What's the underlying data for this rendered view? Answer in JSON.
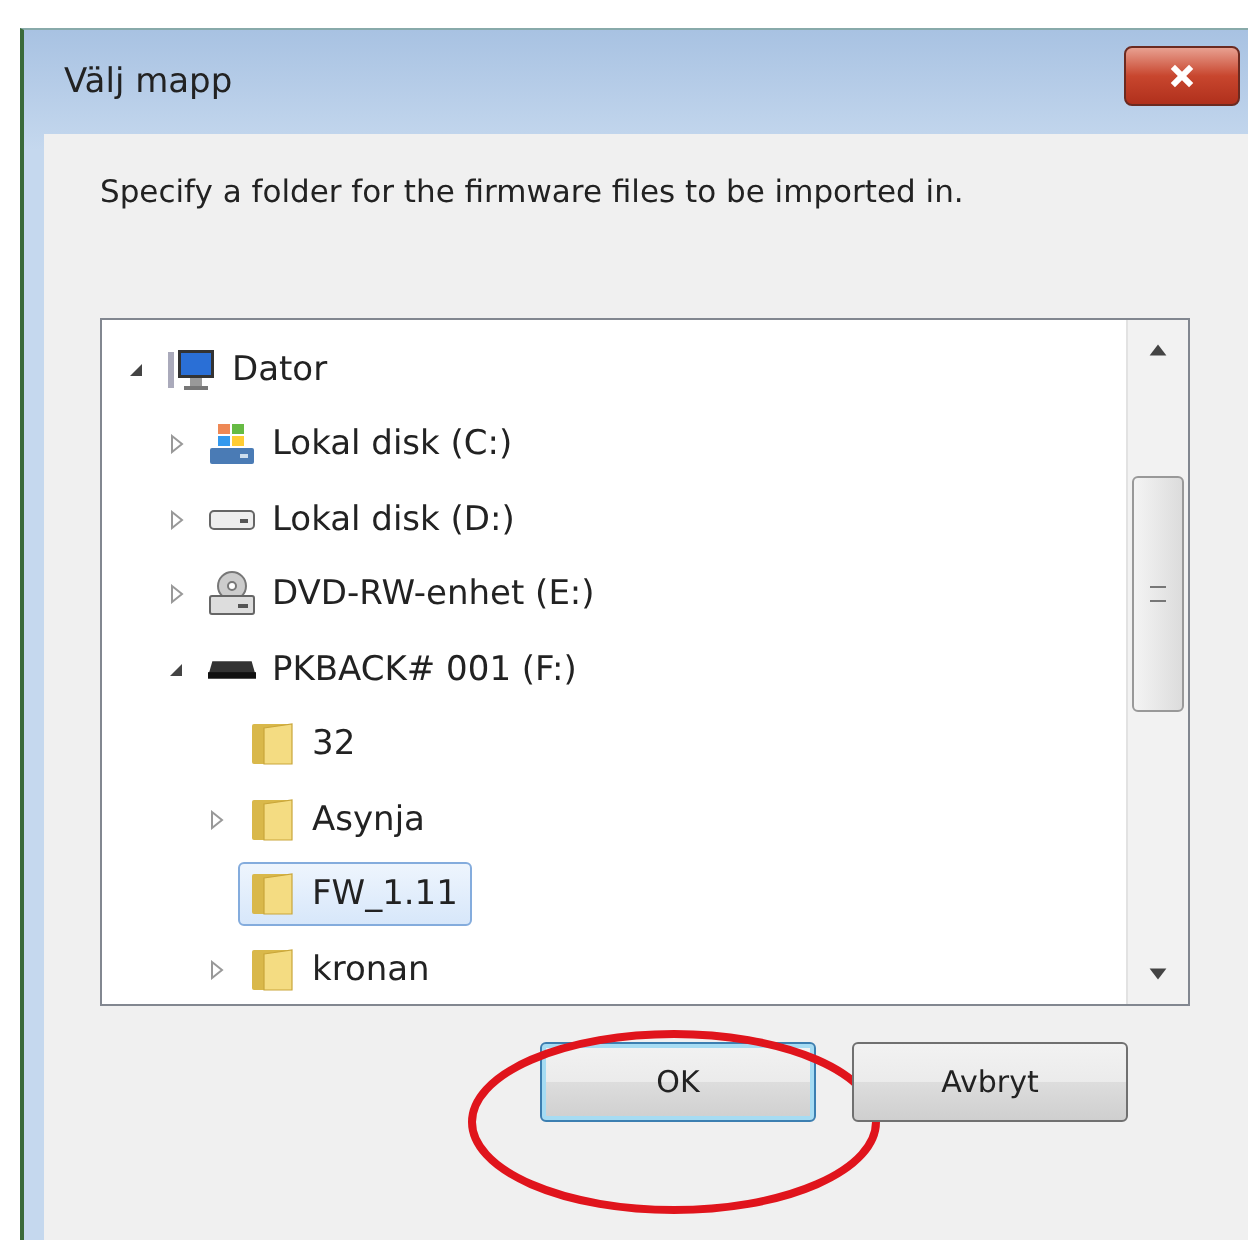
{
  "window": {
    "title": "Välj mapp"
  },
  "instruction": "Specify a folder for the firmware files to be imported in.",
  "tree": [
    {
      "label": "Dator",
      "kind": "computer",
      "expanded": true,
      "selected": false,
      "children": [
        {
          "label": "Lokal disk (C:)",
          "kind": "system-drive",
          "expanded": false,
          "selected": false
        },
        {
          "label": "Lokal disk (D:)",
          "kind": "drive",
          "expanded": false,
          "selected": false
        },
        {
          "label": "DVD-RW-enhet (E:)",
          "kind": "dvd-drive",
          "expanded": false,
          "selected": false
        },
        {
          "label": "PKBACK# 001 (F:)",
          "kind": "usb-drive",
          "expanded": true,
          "selected": false,
          "children": [
            {
              "label": "32",
              "kind": "folder",
              "selected": false
            },
            {
              "label": "Asynja",
              "kind": "folder",
              "expanded": false,
              "selected": false
            },
            {
              "label": "FW_1.11",
              "kind": "folder",
              "selected": true
            },
            {
              "label": "kronan",
              "kind": "folder",
              "expanded": false,
              "selected": false
            }
          ]
        }
      ]
    }
  ],
  "buttons": [
    {
      "label": "OK",
      "kind": "default",
      "highlighted": true
    },
    {
      "label": "Avbryt",
      "kind": "normal",
      "highlighted": false
    }
  ]
}
